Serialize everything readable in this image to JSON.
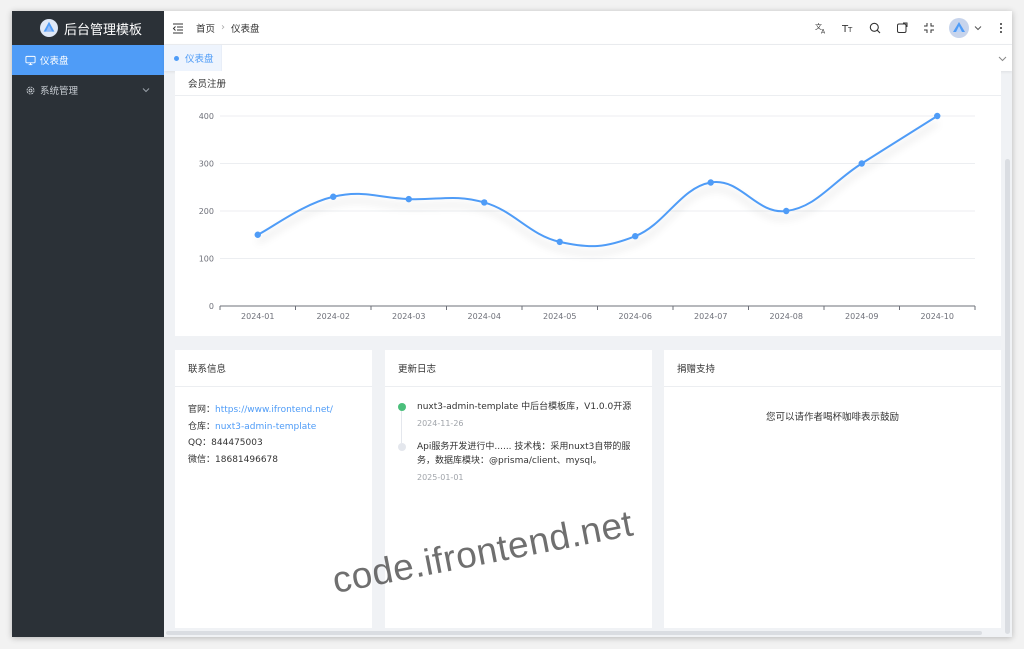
{
  "app": {
    "title": "后台管理模板"
  },
  "sidebar": {
    "items": [
      {
        "label": "仪表盘",
        "icon": "monitor-icon",
        "active": true
      },
      {
        "label": "系统管理",
        "icon": "gear-icon",
        "active": false
      }
    ]
  },
  "header": {
    "breadcrumb": [
      "首页",
      "仪表盘"
    ],
    "tools": [
      "translate-icon",
      "font-size-icon",
      "search-icon",
      "external-window-icon",
      "fullscreen-exit-icon"
    ]
  },
  "tabs": [
    {
      "label": "仪表盘",
      "active": true
    }
  ],
  "cards": {
    "chart": {
      "title": "会员注册"
    },
    "contact": {
      "title": "联系信息",
      "rows": [
        {
          "label": "官网：",
          "value": "https://www.ifrontend.net/",
          "link": true
        },
        {
          "label": "仓库：",
          "value": "nuxt3-admin-template",
          "link": true
        },
        {
          "label": "QQ：",
          "value": "844475003",
          "link": false
        },
        {
          "label": "微信：",
          "value": "18681496678",
          "link": false
        }
      ]
    },
    "changelog": {
      "title": "更新日志",
      "items": [
        {
          "text": "nuxt3-admin-template 中后台模板库，V1.0.0开源",
          "date": "2024-11-26",
          "status": "done"
        },
        {
          "text": "Api服务开发进行中...... 技术栈：采用nuxt3自带的服务，数据库模块：@prisma/client、mysql。",
          "date": "2025-01-01",
          "status": "pending"
        }
      ]
    },
    "donate": {
      "title": "捐赠支持",
      "text": "您可以请作者喝杯咖啡表示鼓励"
    }
  },
  "watermark": "code.ifrontend.net",
  "colors": {
    "accent": "#4f9cf7",
    "sidebar": "#2b3137",
    "success": "#4bbf7b"
  },
  "chart_data": {
    "type": "line",
    "smooth": true,
    "categories": [
      "2024-01",
      "2024-02",
      "2024-03",
      "2024-04",
      "2024-05",
      "2024-06",
      "2024-07",
      "2024-08",
      "2024-09",
      "2024-10"
    ],
    "series": [
      {
        "values": [
          150,
          230,
          225,
          218,
          135,
          147,
          260,
          200,
          300,
          400
        ]
      }
    ],
    "yticks": [
      0,
      100,
      200,
      300,
      400
    ],
    "ylim": [
      0,
      400
    ],
    "grid": true,
    "color": "#4f9cf7"
  }
}
